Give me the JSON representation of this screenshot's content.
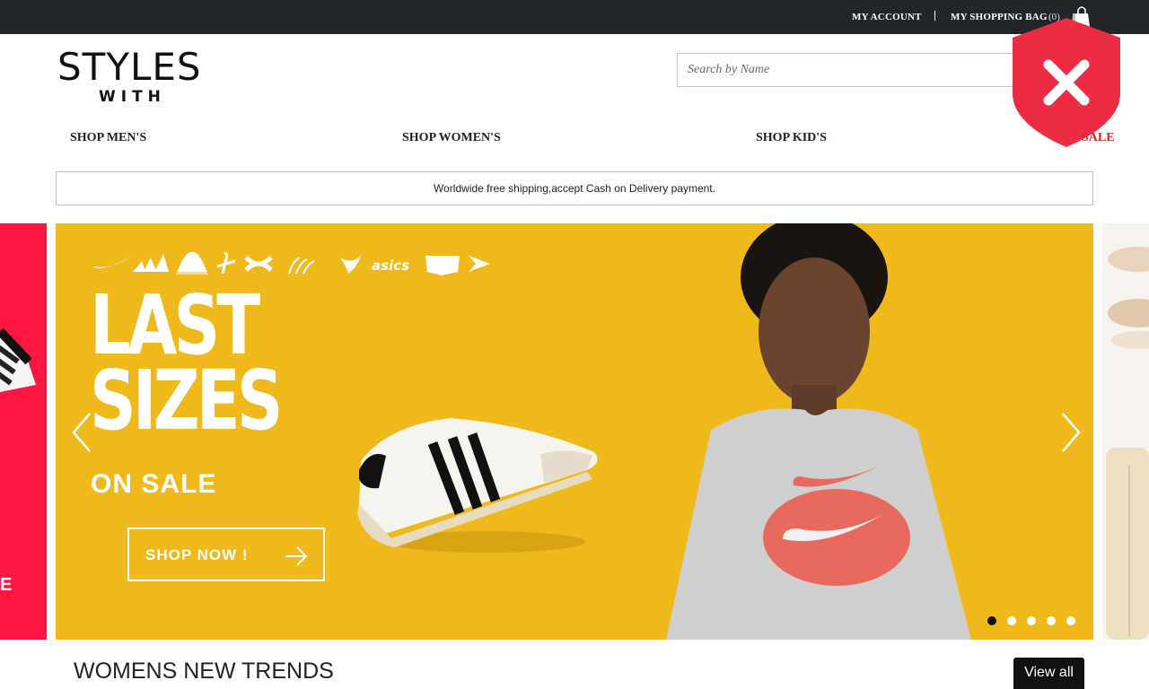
{
  "topbar": {
    "account_label": "MY ACCOUNT",
    "bag_label": "MY SHOPPING BAG",
    "bag_count": "(0)",
    "bag_icon": "shopping-bag-icon"
  },
  "header": {
    "logo_line1": "STYLES",
    "logo_line2": "WITH",
    "search_placeholder": "Search by Name",
    "security_badge_icon": "shield-close-icon"
  },
  "nav": {
    "men": "SHOP MEN'S",
    "women": "SHOP WOMEN'S",
    "kids": "SHOP KID'S",
    "sale": "SALE"
  },
  "shipping_notice": "Worldwide free shipping,accept Cash on Delivery payment.",
  "banner": {
    "headline_line1": "LAST",
    "headline_line2": "SIZES",
    "subline": "ON SALE",
    "cta_label": "SHOP NOW !",
    "slide_count": 5,
    "active_slide": 1,
    "left_peek_text": "E",
    "colors": {
      "banner_bg": "#efb81b",
      "left_peek_bg": "#ff1744",
      "sale": "#d42a2a"
    }
  },
  "section": {
    "title": "WOMENS NEW TRENDS",
    "view_all_label": "View all"
  }
}
